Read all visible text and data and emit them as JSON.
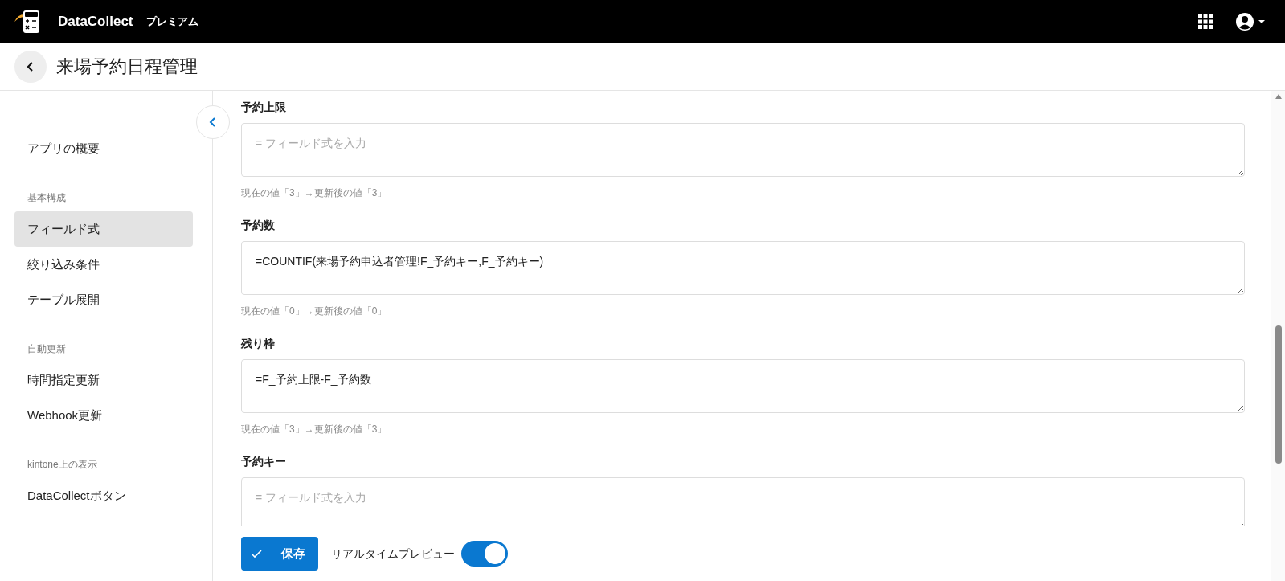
{
  "header": {
    "app_name": "DataCollect",
    "edition": "プレミアム"
  },
  "page": {
    "title": "来場予約日程管理"
  },
  "sidebar": {
    "groups": [
      {
        "items": [
          {
            "label": "アプリの概要",
            "selected": false
          }
        ]
      },
      {
        "heading": "基本構成",
        "items": [
          {
            "label": "フィールド式",
            "selected": true
          },
          {
            "label": "絞り込み条件",
            "selected": false
          },
          {
            "label": "テーブル展開",
            "selected": false
          }
        ]
      },
      {
        "heading": "自動更新",
        "items": [
          {
            "label": "時間指定更新",
            "selected": false
          },
          {
            "label": "Webhook更新",
            "selected": false
          }
        ]
      },
      {
        "heading": "kintone上の表示",
        "items": [
          {
            "label": "DataCollectボタン",
            "selected": false
          }
        ]
      }
    ]
  },
  "fields": [
    {
      "label": "予約上限",
      "placeholder": "= フィールド式を入力",
      "note": "現在の値「3」→更新後の値「3」"
    },
    {
      "label": "予約数",
      "value": "=COUNTIF(来場予約申込者管理!F_予約キー,F_予約キー)",
      "note": "現在の値「0」→更新後の値「0」"
    },
    {
      "label": "残り枠",
      "value": "=F_予約上限-F_予約数",
      "note": "現在の値「3」→更新後の値「3」"
    },
    {
      "label": "予約キー",
      "placeholder": "= フィールド式を入力"
    }
  ],
  "footer": {
    "save": "保存",
    "preview_label": "リアルタイムプレビュー",
    "preview_on": true
  }
}
